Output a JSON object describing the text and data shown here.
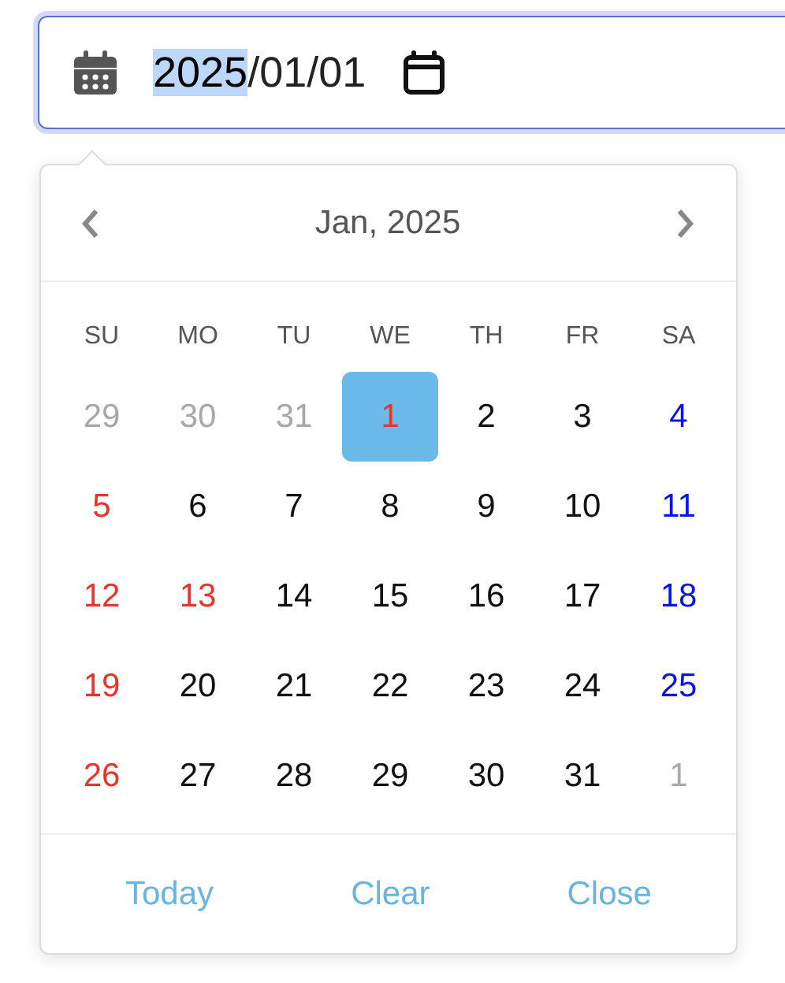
{
  "date_field": {
    "parts": [
      {
        "text": "2025",
        "selected": true
      },
      {
        "text": "/01/01",
        "selected": false
      }
    ]
  },
  "calendar": {
    "title": "Jan, 2025",
    "weekdays": [
      "SU",
      "MO",
      "TU",
      "WE",
      "TH",
      "FR",
      "SA"
    ],
    "days": [
      {
        "label": "29",
        "kind": "other",
        "selected": false
      },
      {
        "label": "30",
        "kind": "other",
        "selected": false
      },
      {
        "label": "31",
        "kind": "other",
        "selected": false
      },
      {
        "label": "1",
        "kind": "holiday",
        "selected": true
      },
      {
        "label": "2",
        "kind": "weekday",
        "selected": false
      },
      {
        "label": "3",
        "kind": "weekday",
        "selected": false
      },
      {
        "label": "4",
        "kind": "saturday",
        "selected": false
      },
      {
        "label": "5",
        "kind": "holiday",
        "selected": false
      },
      {
        "label": "6",
        "kind": "weekday",
        "selected": false
      },
      {
        "label": "7",
        "kind": "weekday",
        "selected": false
      },
      {
        "label": "8",
        "kind": "weekday",
        "selected": false
      },
      {
        "label": "9",
        "kind": "weekday",
        "selected": false
      },
      {
        "label": "10",
        "kind": "weekday",
        "selected": false
      },
      {
        "label": "11",
        "kind": "saturday",
        "selected": false
      },
      {
        "label": "12",
        "kind": "holiday",
        "selected": false
      },
      {
        "label": "13",
        "kind": "holiday",
        "selected": false
      },
      {
        "label": "14",
        "kind": "weekday",
        "selected": false
      },
      {
        "label": "15",
        "kind": "weekday",
        "selected": false
      },
      {
        "label": "16",
        "kind": "weekday",
        "selected": false
      },
      {
        "label": "17",
        "kind": "weekday",
        "selected": false
      },
      {
        "label": "18",
        "kind": "saturday",
        "selected": false
      },
      {
        "label": "19",
        "kind": "holiday",
        "selected": false
      },
      {
        "label": "20",
        "kind": "weekday",
        "selected": false
      },
      {
        "label": "21",
        "kind": "weekday",
        "selected": false
      },
      {
        "label": "22",
        "kind": "weekday",
        "selected": false
      },
      {
        "label": "23",
        "kind": "weekday",
        "selected": false
      },
      {
        "label": "24",
        "kind": "weekday",
        "selected": false
      },
      {
        "label": "25",
        "kind": "saturday",
        "selected": false
      },
      {
        "label": "26",
        "kind": "holiday",
        "selected": false
      },
      {
        "label": "27",
        "kind": "weekday",
        "selected": false
      },
      {
        "label": "28",
        "kind": "weekday",
        "selected": false
      },
      {
        "label": "29",
        "kind": "weekday",
        "selected": false
      },
      {
        "label": "30",
        "kind": "weekday",
        "selected": false
      },
      {
        "label": "31",
        "kind": "weekday",
        "selected": false
      },
      {
        "label": "1",
        "kind": "other",
        "selected": false
      }
    ],
    "buttons": [
      "Today",
      "Clear",
      "Close"
    ]
  }
}
